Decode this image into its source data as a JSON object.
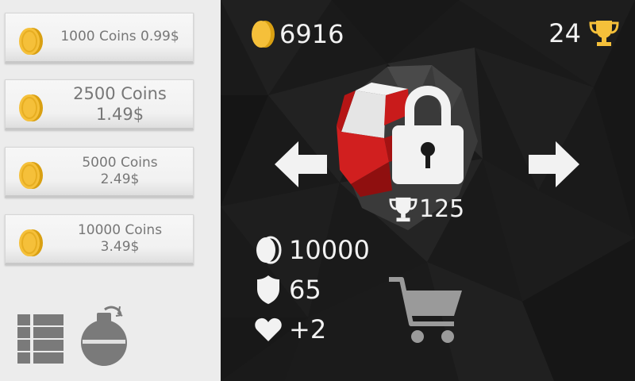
{
  "shop": {
    "offers": [
      {
        "line1": "1000 Coins 0.99$",
        "line2": ""
      },
      {
        "line1": "2500 Coins",
        "line2": "1.49$"
      },
      {
        "line1": "5000 Coins",
        "line2": "2.49$"
      },
      {
        "line1": "10000 Coins",
        "line2": "3.49$"
      }
    ],
    "tools": {
      "list_icon": "list-icon",
      "bomb_icon": "bomb-icon"
    }
  },
  "hud": {
    "coins": "6916",
    "trophies": "24"
  },
  "skin": {
    "locked": true,
    "unlock_trophies": "125",
    "price": "10000",
    "armor": "65",
    "health_bonus": "+2"
  },
  "colors": {
    "coin": "#f5c03a",
    "trophy": "#f5c03a",
    "skin_red": "#d11f1f",
    "panel": "#ececec",
    "cart": "#9a9a9a"
  }
}
